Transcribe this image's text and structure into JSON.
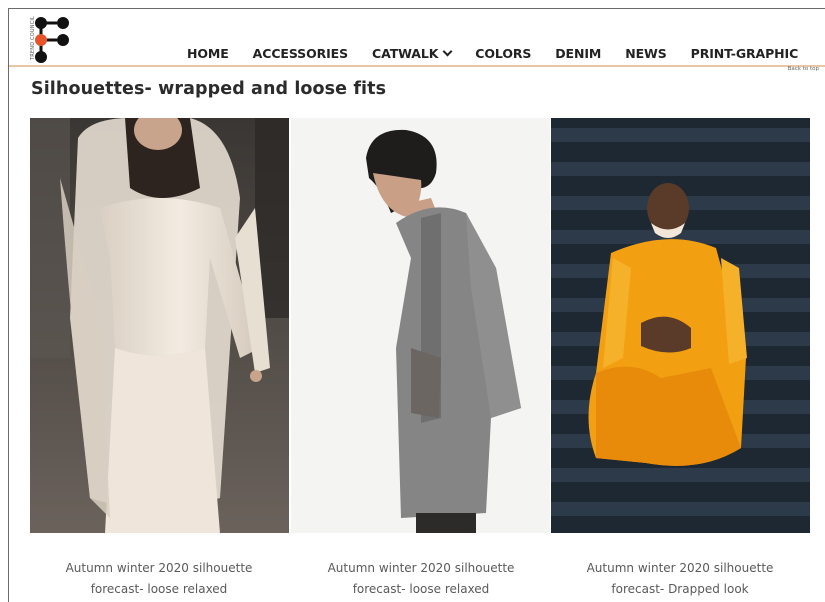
{
  "header": {
    "logo_text": "TREND COUNCIL",
    "nav": [
      {
        "label": "HOME"
      },
      {
        "label": "ACCESSORIES"
      },
      {
        "label": "CATWALK",
        "has_dropdown": true
      },
      {
        "label": "COLORS"
      },
      {
        "label": "DENIM"
      },
      {
        "label": "NEWS"
      },
      {
        "label": "PRINT-GRAPHIC"
      }
    ],
    "back_to_top": "Back to top"
  },
  "main": {
    "title": "Silhouettes- wrapped and loose fits",
    "cards": [
      {
        "image": "runway-model-cream-hooded-wrap",
        "caption_line1": "Autumn winter 2020 silhouette",
        "caption_line2": "forecast- loose relaxed"
      },
      {
        "image": "man-grey-kimono-coat",
        "caption_line1": "Autumn winter 2020 silhouette",
        "caption_line2": "forecast- loose relaxed"
      },
      {
        "image": "monk-saffron-robe-on-steps",
        "caption_line1": "Autumn winter 2020 silhouette",
        "caption_line2": "forecast- Drapped look"
      }
    ]
  },
  "colors": {
    "header_rule": "#e6c8a4",
    "logo_accent": "#e8542a",
    "text_dark": "#222222",
    "caption": "#5a5a5a"
  }
}
